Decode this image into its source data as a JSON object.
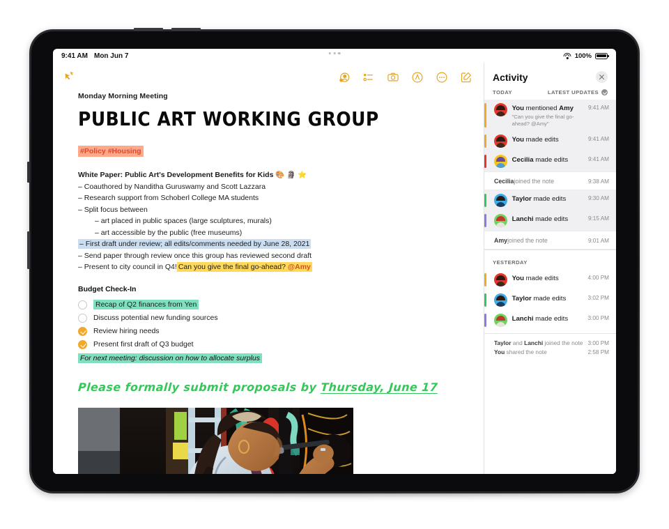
{
  "status_bar": {
    "time": "9:41 AM",
    "date": "Mon Jun 7",
    "battery_percent": "100%",
    "wifi_icon": "wifi-icon",
    "battery_icon": "battery-icon"
  },
  "toolbar": {
    "icons": [
      {
        "name": "add-collaborator-icon",
        "label": "Add People"
      },
      {
        "name": "checklist-icon",
        "label": "Checklist"
      },
      {
        "name": "camera-icon",
        "label": "Insert Media"
      },
      {
        "name": "markup-icon",
        "label": "Markup"
      },
      {
        "name": "more-icon",
        "label": "More"
      },
      {
        "name": "compose-icon",
        "label": "New Note"
      }
    ]
  },
  "note": {
    "kicker": "Monday Morning Meeting",
    "title": "PUBLIC ART WORKING GROUP",
    "tags": "#Policy #Housing",
    "white_paper_heading": "White Paper: Public Art's Development Benefits for Kids",
    "white_paper_emoji": "🎨 🗿 ⭐",
    "bullets": [
      "– Coauthored by Nanditha Guruswamy and Scott Lazzara",
      "– Research support from Schoberl College MA students",
      "– Split focus between"
    ],
    "sub_bullets": [
      "– art placed in public spaces (large sculptures, murals)",
      "– art accessible by the public (free museums)"
    ],
    "highlighted_blue": "– First draft under review; all edits/comments needed by June 28, 2021",
    "bullet_after": "– Send paper through review once this group has reviewed second draft",
    "council_prefix": "– Present to city council in Q4!",
    "council_highlight": "Can you give the final go-ahead?",
    "council_mention": "@Amy",
    "budget_heading": "Budget Check-In",
    "checklist": [
      {
        "label": "Recap of Q2 finances from Yen",
        "checked": false,
        "highlight": "green"
      },
      {
        "label": "Discuss potential new funding sources",
        "checked": false,
        "highlight": "none"
      },
      {
        "label": "Review hiring needs",
        "checked": true,
        "highlight": "none"
      },
      {
        "label": "Present first draft of Q3 budget",
        "checked": true,
        "highlight": "none"
      }
    ],
    "next_meeting_note": "For next meeting: discussion on how to allocate surplus",
    "handwritten_prefix": "Please formally submit proposals by ",
    "handwritten_underlined": "Thursday, June 17",
    "photo_alt": "Woman painting a colorful floral mural on a dark wall"
  },
  "activity": {
    "title": "Activity",
    "close_label": "×",
    "today_label": "TODAY",
    "latest_updates_label": "LATEST UPDATES",
    "yesterday_label": "YESTERDAY",
    "today_items": [
      {
        "actor": "You",
        "action": " mentioned ",
        "target": "Amy",
        "quote": "\"Can you give the final go-ahead? @Amy\"",
        "time": "9:41 AM",
        "avatar_color": "#E5352B",
        "bar_color": "#F0A92B",
        "highlight": true
      },
      {
        "actor": "You",
        "action": " made edits",
        "target": "",
        "quote": "",
        "time": "9:41 AM",
        "avatar_color": "#E5352B",
        "bar_color": "#F0A92B",
        "highlight": true
      },
      {
        "actor": "Cecilia",
        "action": " made edits",
        "target": "",
        "quote": "",
        "time": "9:41 AM",
        "avatar_color": "#F5C518",
        "bar_color": "#E5352B",
        "highlight": true
      }
    ],
    "today_joined": {
      "actor": "Cecilia",
      "text": " joined the note",
      "time": "9:38 AM"
    },
    "today_items_2": [
      {
        "actor": "Taylor",
        "action": " made edits",
        "time": "9:30 AM",
        "avatar_color": "#3AACE8",
        "bar_color": "#34C759",
        "highlight": true
      },
      {
        "actor": "Lanchi",
        "action": " made edits",
        "time": "9:15 AM",
        "avatar_color": "#6FD35F",
        "bar_color": "#8E77E8",
        "highlight": true
      }
    ],
    "today_joined_2": {
      "actor": "Amy",
      "text": " joined the note",
      "time": "9:01 AM"
    },
    "yesterday_items": [
      {
        "actor": "You",
        "action": " made edits",
        "time": "4:00 PM",
        "avatar_color": "#E5352B",
        "bar_color": "#F0A92B",
        "highlight": false
      },
      {
        "actor": "Taylor",
        "action": " made edits",
        "time": "3:02 PM",
        "avatar_color": "#3AACE8",
        "bar_color": "#34C759",
        "highlight": false
      },
      {
        "actor": "Lanchi",
        "action": " made edits",
        "time": "3:00 PM",
        "avatar_color": "#6FD35F",
        "bar_color": "#8E77E8",
        "highlight": false
      }
    ],
    "yesterday_footer": [
      {
        "bold_a": "Taylor",
        "mid": " and ",
        "bold_b": "Lanchi",
        "rest": " joined the note",
        "time": "3:00 PM"
      },
      {
        "bold_a": "You",
        "mid": "",
        "bold_b": "",
        "rest": " shared the note",
        "time": "2:58 PM"
      }
    ]
  },
  "colors": {
    "accent_yellow": "#E8A51E",
    "highlight_orange": "#FFA98A",
    "highlight_blue": "#CBDDF0",
    "highlight_yellow": "#FFD95C",
    "highlight_green": "#7FE0C0",
    "handwriting_green": "#35C759"
  }
}
